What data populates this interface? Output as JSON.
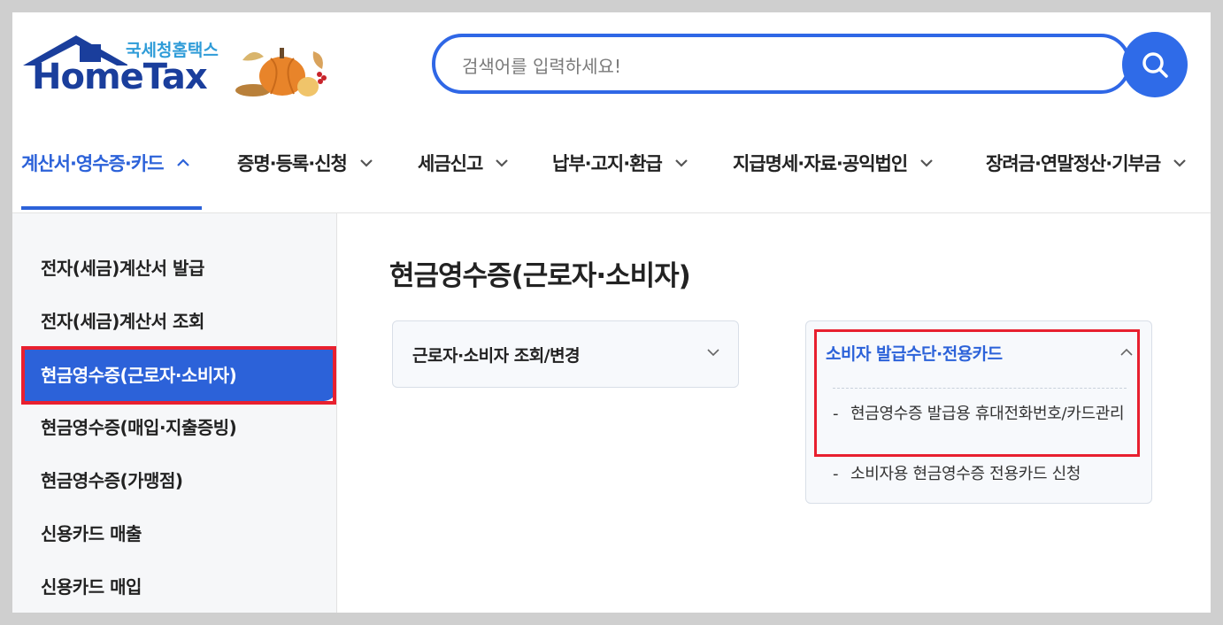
{
  "logo": {
    "korean": "국세청홈택스",
    "english": "HomeTax"
  },
  "search": {
    "placeholder": "검색어를 입력하세요!"
  },
  "nav": {
    "items": [
      {
        "label": "계산서·영수증·카드",
        "active": true
      },
      {
        "label": "증명·등록·신청",
        "active": false
      },
      {
        "label": "세금신고",
        "active": false
      },
      {
        "label": "납부·고지·환급",
        "active": false
      },
      {
        "label": "지급명세·자료·공익법인",
        "active": false
      },
      {
        "label": "장려금·연말정산·기부금",
        "active": false
      }
    ]
  },
  "sidebar": {
    "items": [
      {
        "label": "전자(세금)계산서 발급"
      },
      {
        "label": "전자(세금)계산서 조회"
      },
      {
        "label": "현금영수증(근로자·소비자)",
        "active": true
      },
      {
        "label": "현금영수증(매입·지출증빙)"
      },
      {
        "label": "현금영수증(가맹점)"
      },
      {
        "label": "신용카드 매출"
      },
      {
        "label": "신용카드 매입"
      }
    ]
  },
  "main": {
    "title": "현금영수증(근로자·소비자)",
    "cards": [
      {
        "label": "근로자·소비자 조회/변경",
        "expanded": false
      },
      {
        "label": "소비자 발급수단·전용카드",
        "expanded": true,
        "items": [
          {
            "label": "현금영수증 발급용 휴대전화번호/카드관리"
          },
          {
            "label": "소비자용 현금영수증 전용카드 신청"
          }
        ]
      }
    ]
  },
  "colors": {
    "accent": "#2c62d9",
    "highlight": "#e8202f",
    "logo_navy": "#1a3e9c",
    "logo_sky": "#2f9cd8"
  }
}
